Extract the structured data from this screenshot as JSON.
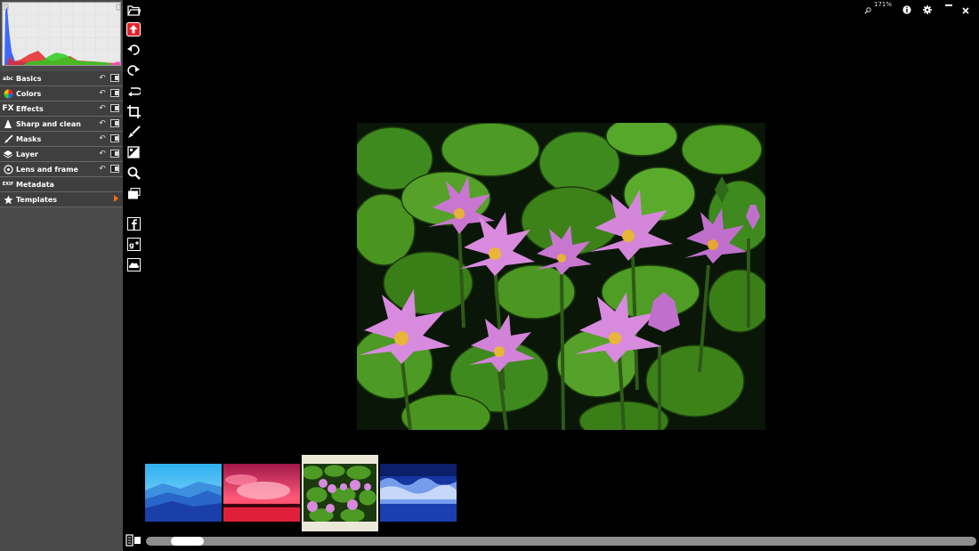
{
  "menu": {
    "items": [
      {
        "label": "Basics",
        "icon": "abc-icon"
      },
      {
        "label": "Colors",
        "icon": "color-wheel-icon"
      },
      {
        "label": "Effects",
        "icon": "fx-icon"
      },
      {
        "label": "Sharp and clean",
        "icon": "sharpen-icon"
      },
      {
        "label": "Masks",
        "icon": "brush-icon"
      },
      {
        "label": "Layer",
        "icon": "layers-icon"
      },
      {
        "label": "Lens and frame",
        "icon": "lens-icon"
      },
      {
        "label": "Metadata",
        "icon": "exif-icon"
      },
      {
        "label": "Templates",
        "icon": "star-icon"
      }
    ],
    "icon_texts": {
      "abc": "abc",
      "fx": "FX",
      "exif": "EXIF"
    },
    "reset_glyph": "↶"
  },
  "top_right": {
    "zoom": "171%"
  },
  "colors": {
    "accent": "#ff6a1a",
    "upload_red": "#e8202a",
    "panel_bg": "#4a4a4a",
    "scrollbar": "#8e8e8e"
  },
  "thumbnails": [
    {
      "name": "blue-mountains",
      "selected": false
    },
    {
      "name": "pink-sunset",
      "selected": false
    },
    {
      "name": "water-lilies",
      "selected": true
    },
    {
      "name": "blue-waves",
      "selected": false
    }
  ]
}
